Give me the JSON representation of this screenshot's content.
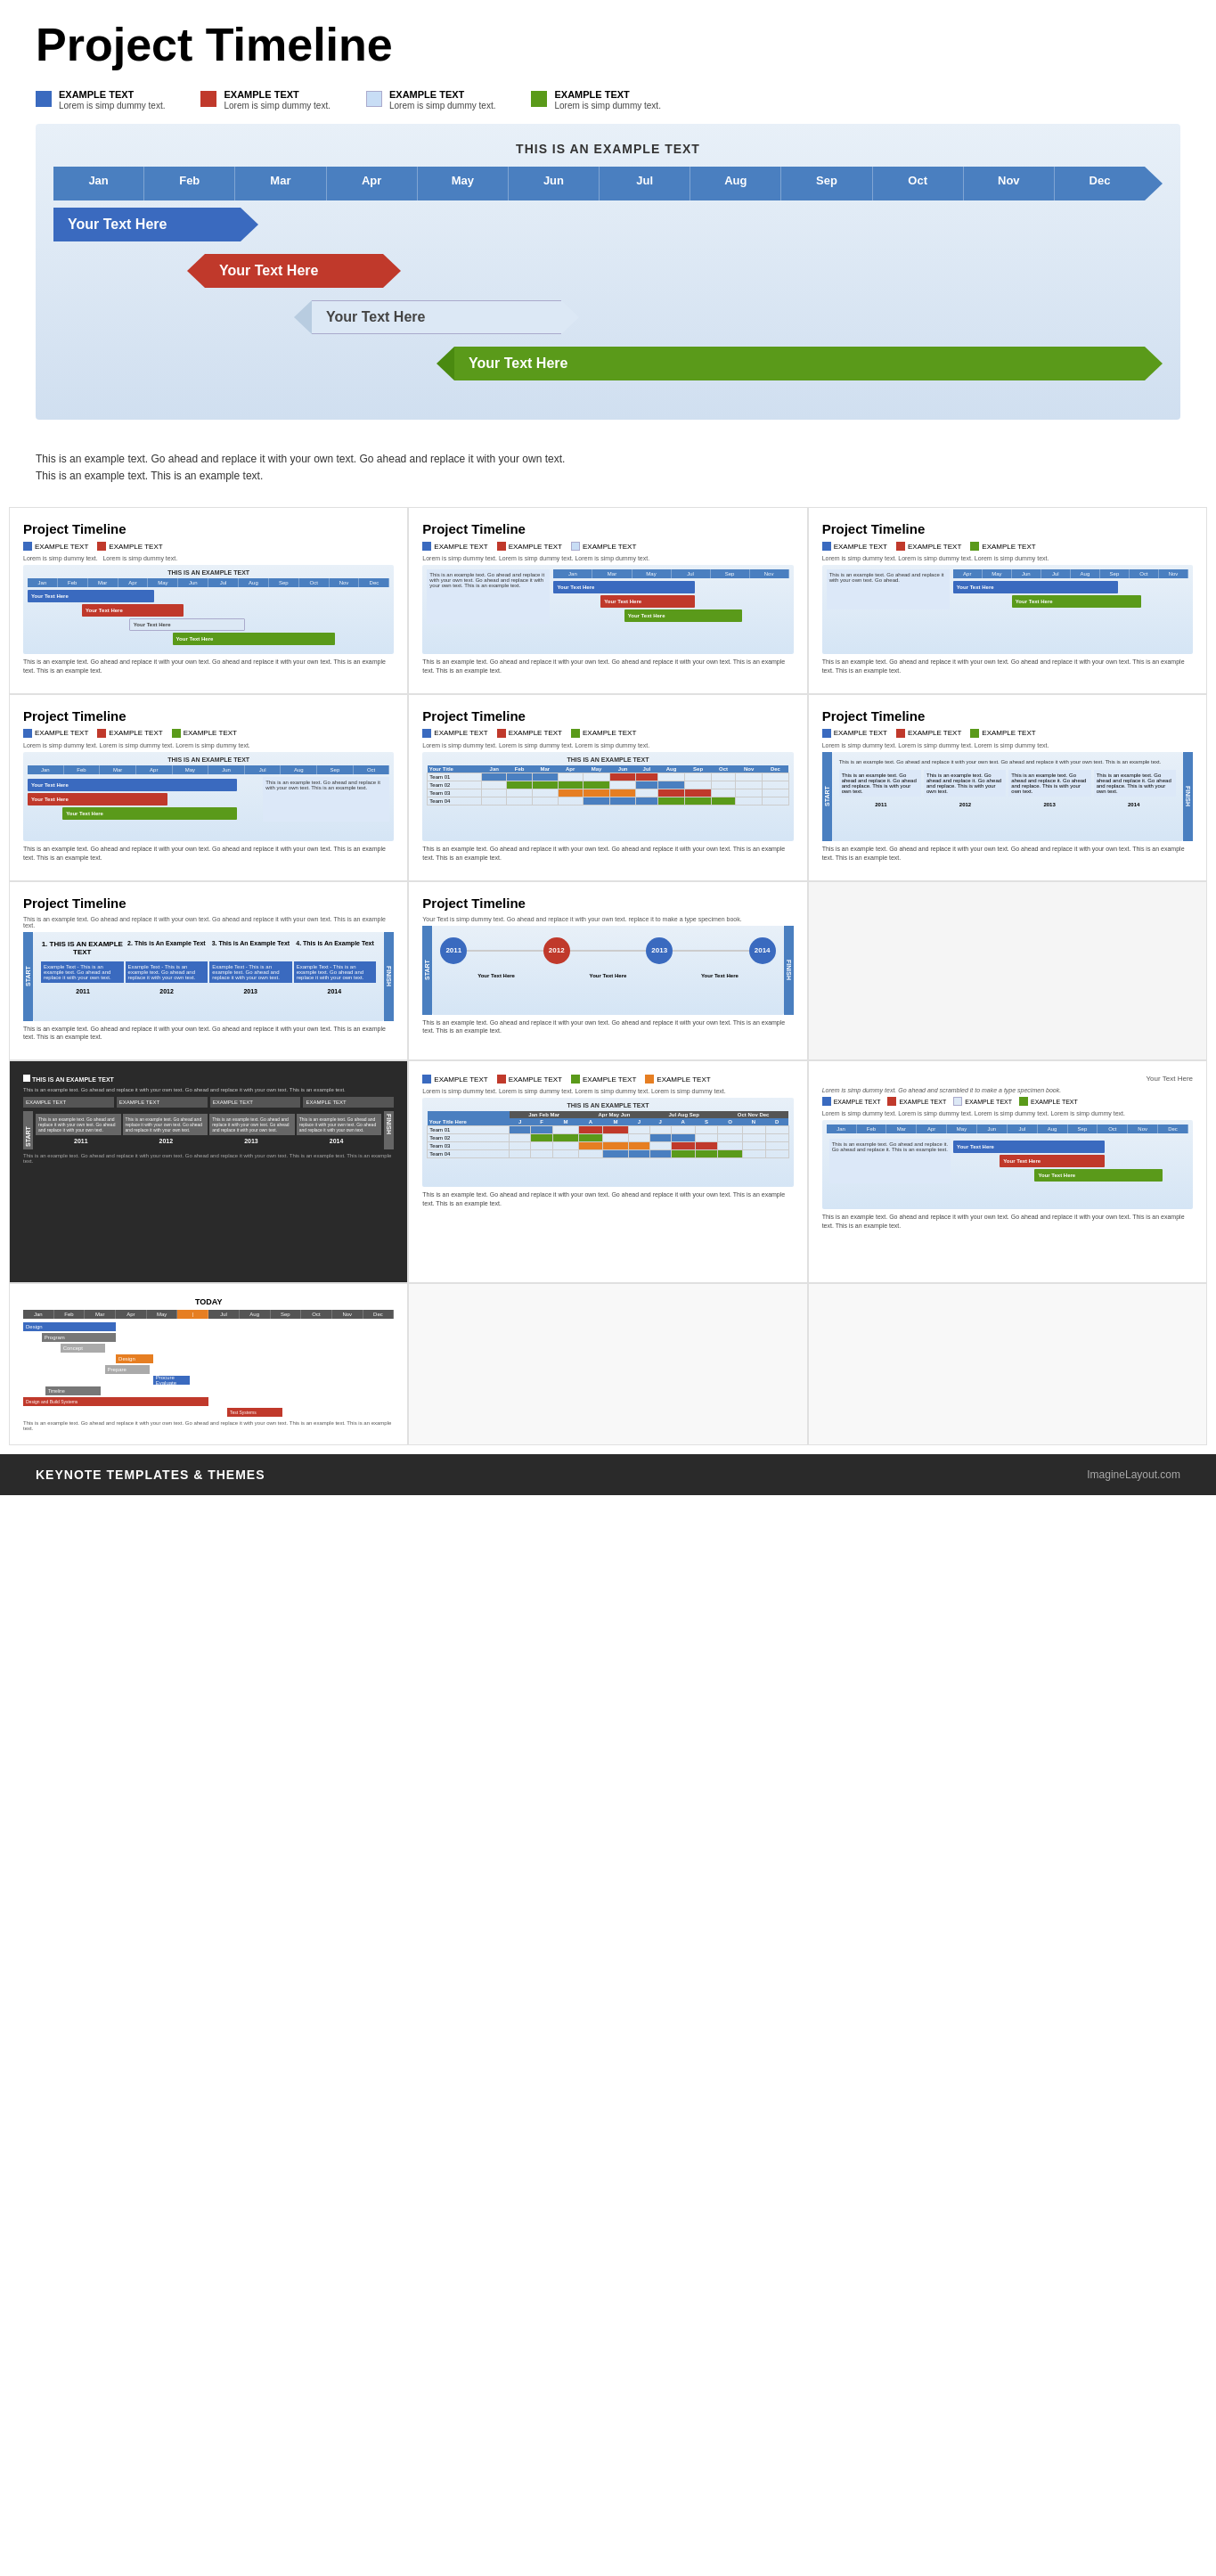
{
  "header": {
    "title": "Project Timeline"
  },
  "legend": [
    {
      "color": "#3a6abf",
      "title": "EXAMPLE TEXT",
      "sub": "Lorem is simp dummy text."
    },
    {
      "color": "#c0392b",
      "title": "EXAMPLE TEXT",
      "sub": "Lorem is simp dummy text."
    },
    {
      "color": "#c8ddf5",
      "title": "EXAMPLE TEXT",
      "sub": "Lorem is simp dummy text."
    },
    {
      "color": "#5a9a1a",
      "title": "EXAMPLE TEXT",
      "sub": "Lorem is simp dummy text."
    }
  ],
  "main_timeline": {
    "example_title": "THIS IS AN EXAMPLE TEXT",
    "months": [
      "Jan",
      "Feb",
      "Mar",
      "Apr",
      "May",
      "Jun",
      "Jul",
      "Aug",
      "Sep",
      "Oct",
      "Nov",
      "Dec"
    ],
    "bars": [
      {
        "text": "Your  Text Here",
        "color": "#3a6abf",
        "start": 0,
        "width": 25
      },
      {
        "text": "Your  Text Here",
        "color": "#c0392b",
        "start": 18,
        "width": 22
      },
      {
        "text": "Your  Text Here",
        "color": "#c8ddf5",
        "start": 33,
        "width": 30,
        "textColor": "#444"
      },
      {
        "text": "Your  Text Here",
        "color": "#5a9a1a",
        "start": 50,
        "width": 45
      }
    ]
  },
  "description": "This is an example text. Go ahead and replace it with your own text. Go ahead and replace it with your own text. This is an example text. This is an example text.",
  "thumbnails_row1": [
    {
      "title": "Project Timeline"
    },
    {
      "title": "Project Timeline"
    },
    {
      "title": "Project Timeline"
    }
  ],
  "thumbnails_row2": [
    {
      "title": "Project Timeline"
    },
    {
      "title": "Project Timeline"
    },
    {
      "title": "Project Timeline"
    }
  ],
  "thumbnails_row3": [
    {
      "title": "Project Timeline"
    },
    {
      "title": "Project Timeline"
    }
  ],
  "footer": {
    "left": "KEYNOTE TEMPLATES & THEMES",
    "right": "ImagineLayout.com"
  },
  "months_short": [
    "Jan",
    "Feb",
    "Mar",
    "Apr",
    "May",
    "Jun",
    "Jul",
    "Aug",
    "Sep",
    "Oct",
    "Nov",
    "Dec"
  ],
  "months_today": [
    "Jan",
    "Feb",
    "Mar",
    "Apr",
    "May",
    "Jul",
    "Aug",
    "Sep",
    "Oct",
    "Nov",
    "Dec"
  ]
}
